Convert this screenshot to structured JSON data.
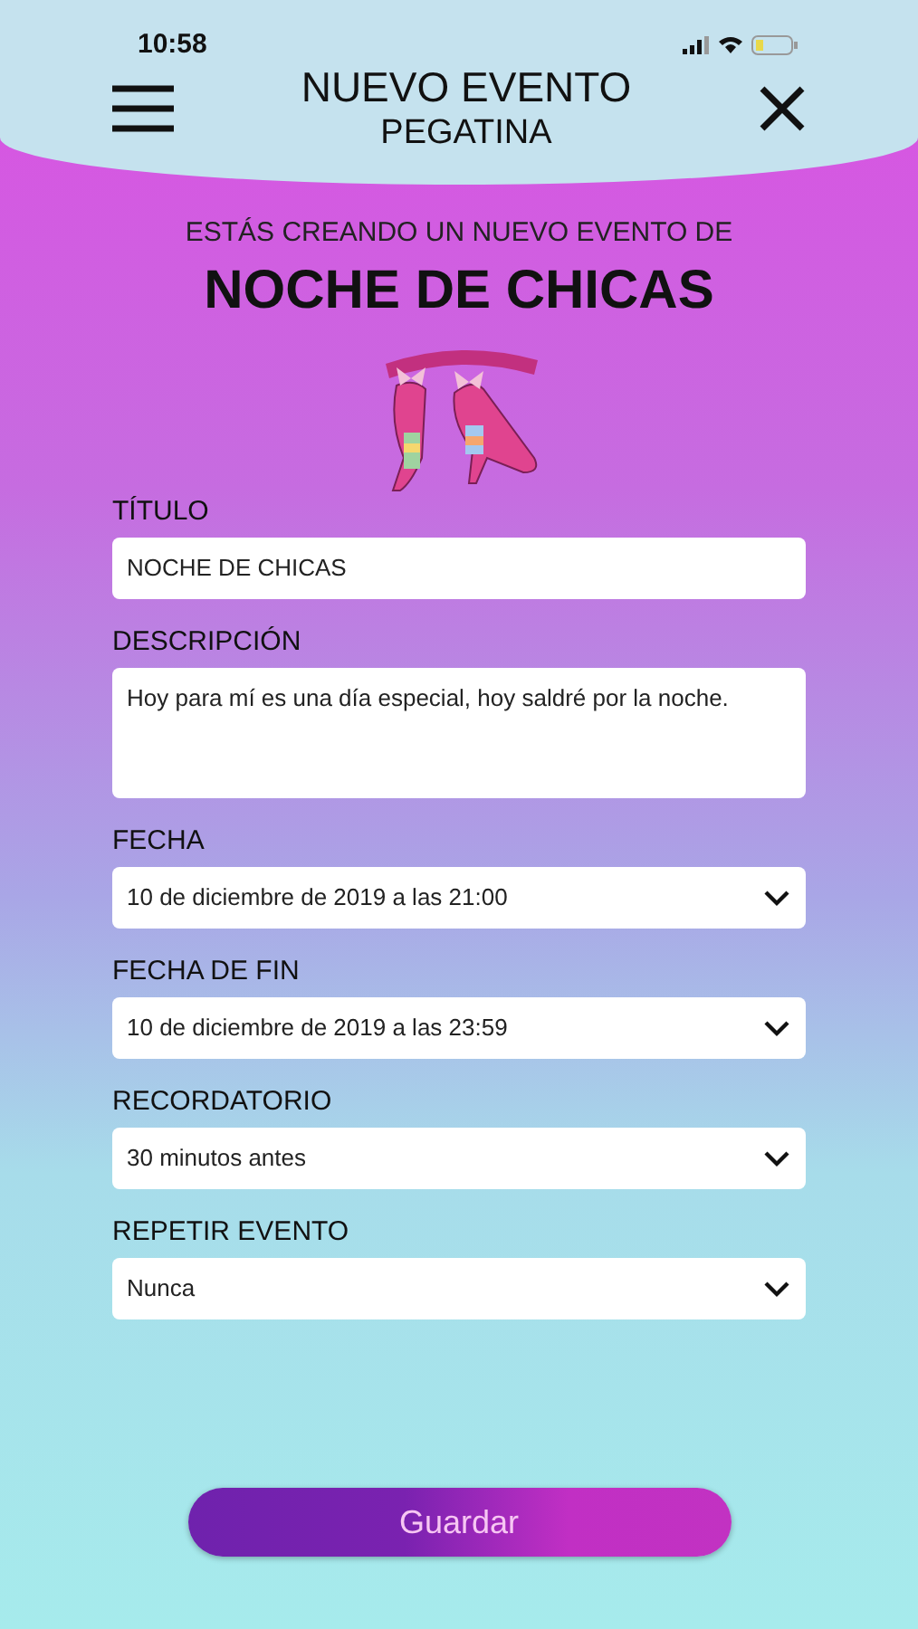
{
  "status_bar": {
    "time": "10:58"
  },
  "header": {
    "title": "NUEVO EVENTO",
    "subtitle": "PEGATINA"
  },
  "intro": {
    "caption": "ESTÁS CREANDO UN NUEVO EVENTO DE",
    "event_name": "NOCHE DE CHICAS"
  },
  "fields": [
    {
      "kind": "text",
      "label": "TÍTULO",
      "value": "NOCHE DE CHICAS"
    },
    {
      "kind": "textarea",
      "label": "DESCRIPCIÓN",
      "value": "Hoy para mí es una día especial, hoy saldré por la noche."
    },
    {
      "kind": "select",
      "label": "FECHA",
      "value": "10 de diciembre de 2019 a las 21:00"
    },
    {
      "kind": "select",
      "label": "FECHA DE FIN",
      "value": "10 de diciembre de 2019 a las 23:59"
    },
    {
      "kind": "select",
      "label": "RECORDATORIO",
      "value": "30 minutos antes"
    },
    {
      "kind": "select",
      "label": "REPETIR EVENTO",
      "value": "Nunca"
    }
  ],
  "save_button": "Guardar"
}
